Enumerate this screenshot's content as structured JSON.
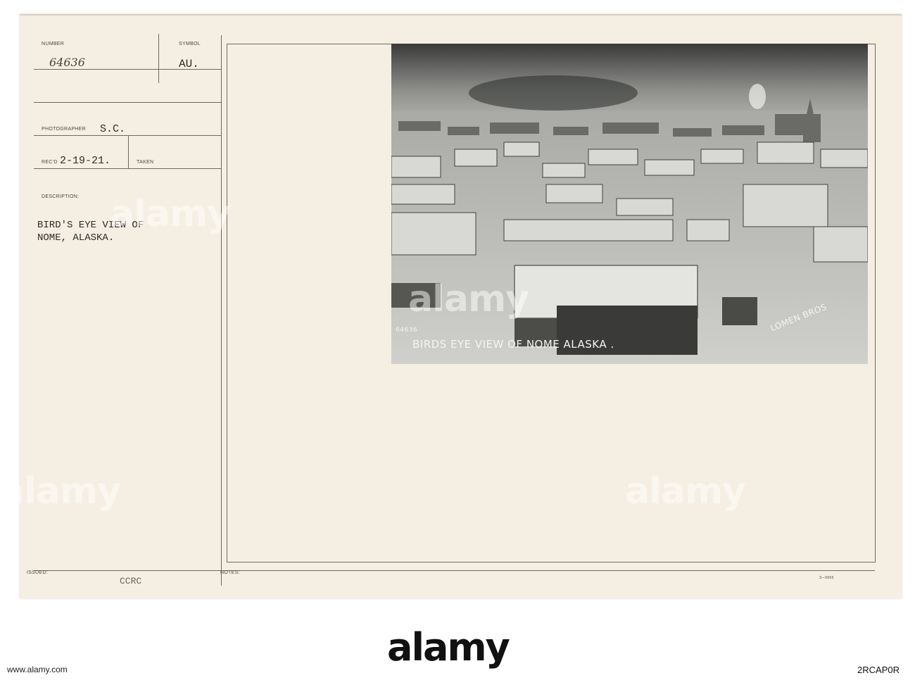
{
  "record": {
    "number_label": "NUMBER",
    "number_value": "64636",
    "symbol_label": "SYMBOL",
    "symbol_value": "AU.",
    "photographer_label": "PHOTOGRAPHER",
    "photographer_value": "S.C.",
    "recd_label": "REC'D",
    "recd_value": "2-19-21.",
    "taken_label": "TAKEN",
    "description_label": "DESCRIPTION:",
    "description_line1": "BIRD'S EYE VIEW OF",
    "description_line2": "NOME, ALASKA.",
    "issued_label": "ISSUED:",
    "issued_value": "CCRC",
    "notes_label": "NOTES:",
    "form_code": "3—5605"
  },
  "photo": {
    "caption": "BIRDS EYE VIEW OF NOME ALASKA .",
    "negative_number": "64636",
    "credit": "LOMEN BROS"
  },
  "watermark": {
    "text": "alamy",
    "footer_id": "2RCAP0R",
    "footer_url": "www.alamy.com"
  },
  "colors": {
    "card": "#f5eee2",
    "rule": "#6e6a62",
    "photo_dark": "#2f302e"
  }
}
